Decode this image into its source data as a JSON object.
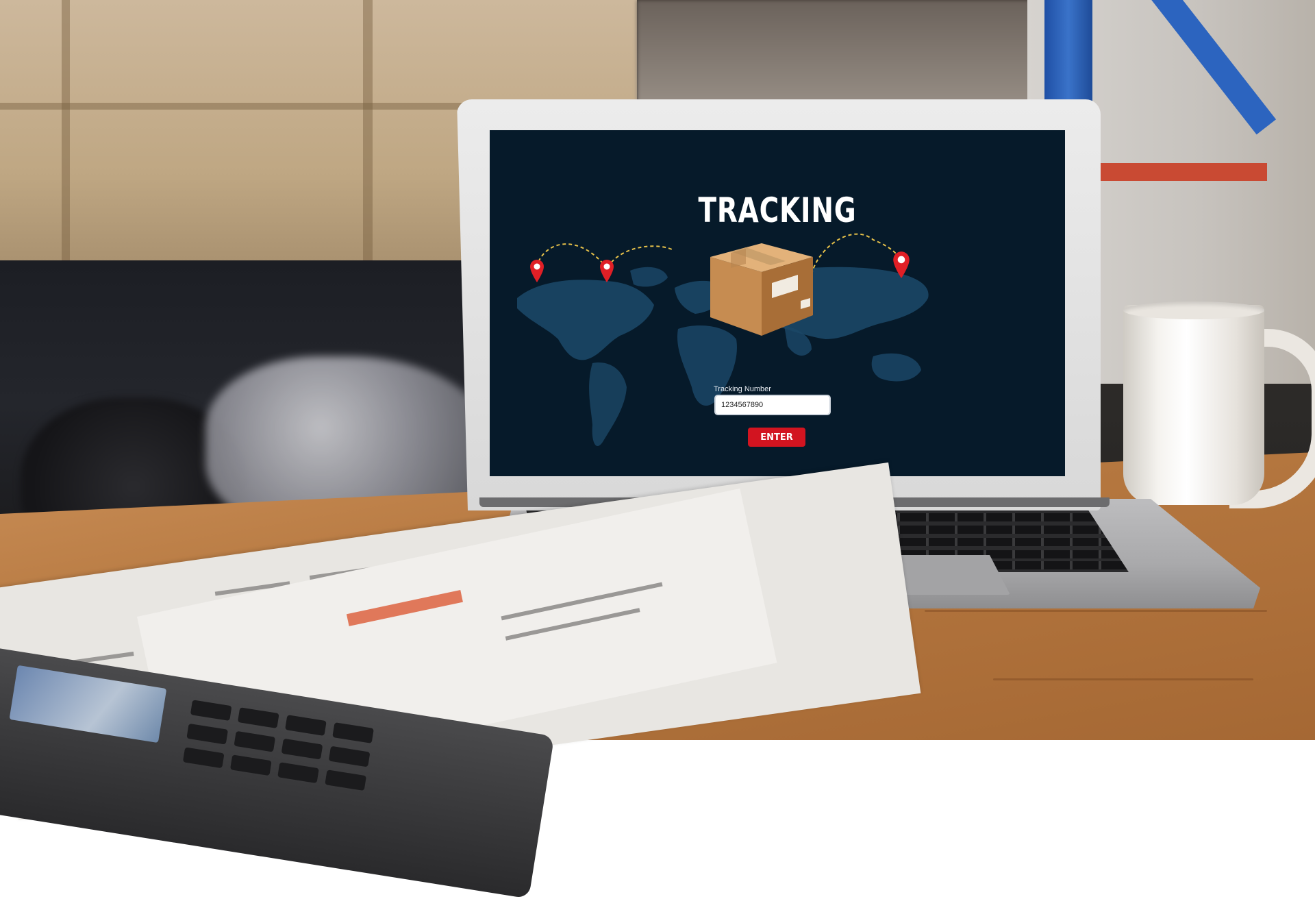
{
  "app": {
    "title": "TRACKING",
    "tracking": {
      "label": "Tracking Number",
      "value": "1234567890"
    },
    "enter_label": "ENTER"
  },
  "colors": {
    "screen_bg": "#061a2a",
    "map": "#1b4766",
    "pin": "#e01f26",
    "route": "#e8c24a",
    "button": "#d21420"
  },
  "icons": {
    "package": "cardboard-box-icon",
    "pin": "location-pin-icon"
  }
}
